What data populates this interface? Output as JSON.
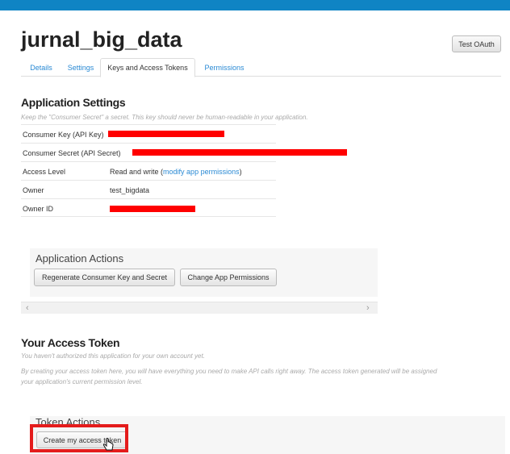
{
  "app": {
    "title": "jurnal_big_data",
    "test_oauth_label": "Test OAuth"
  },
  "tabs": [
    {
      "label": "Details",
      "active": false
    },
    {
      "label": "Settings",
      "active": false
    },
    {
      "label": "Keys and Access Tokens",
      "active": true
    },
    {
      "label": "Permissions",
      "active": false
    }
  ],
  "application_settings": {
    "heading": "Application Settings",
    "note": "Keep the \"Consumer Secret\" a secret. This key should never be human-readable in your application.",
    "rows": [
      {
        "label": "Consumer Key (API Key)",
        "value": "",
        "redacted": true
      },
      {
        "label": "Consumer Secret (API Secret)",
        "value": "",
        "redacted": true
      },
      {
        "label": "Access Level",
        "value": "Read and write",
        "link": "modify app permissions"
      },
      {
        "label": "Owner",
        "value": "test_bigdata"
      },
      {
        "label": "Owner ID",
        "value": "",
        "redacted": true
      }
    ]
  },
  "application_actions": {
    "heading": "Application Actions",
    "regenerate_label": "Regenerate Consumer Key and Secret",
    "change_permissions_label": "Change App Permissions"
  },
  "access_token": {
    "heading": "Your Access Token",
    "note1": "You haven't authorized this application for your own account yet.",
    "note2_line1": "By creating your access token here, you will have everything you need to make API calls right away. The access token generated will be assigned",
    "note2_line2": "your application's current permission level."
  },
  "token_actions": {
    "heading": "Token Actions",
    "create_label": "Create my access token"
  },
  "colors": {
    "topbar": "#0f84c4",
    "link": "#2a8ad4",
    "redaction": "#ff0000",
    "highlight": "#e41c1c"
  }
}
